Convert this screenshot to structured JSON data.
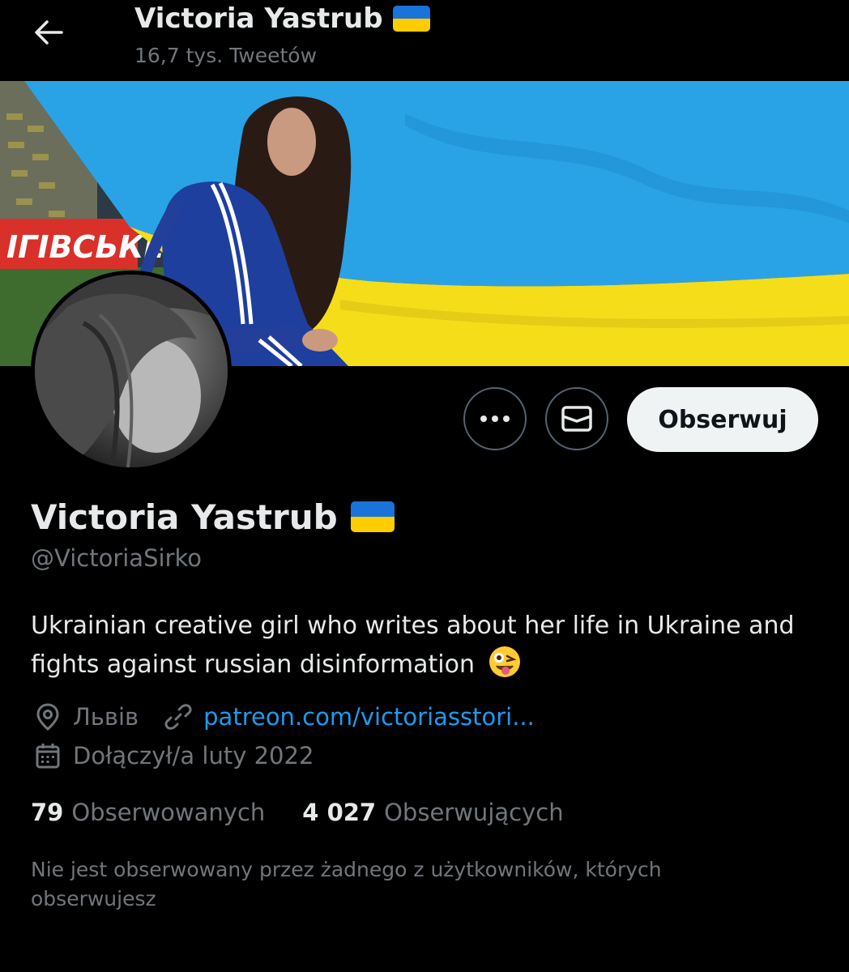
{
  "header": {
    "name": "Victoria Yastrub",
    "tweet_count": "16,7 tys. Tweetów",
    "back_icon": "arrow-left-icon"
  },
  "banner": {
    "sign_text": "ІГІВСЬКЕ",
    "flag_colors": {
      "blue": "#29a3e6",
      "yellow": "#f5dd1a"
    }
  },
  "actions": {
    "more_icon": "more-horizontal-icon",
    "message_icon": "envelope-icon",
    "follow_label": "Obserwuj"
  },
  "profile": {
    "display_name": "Victoria Yastrub",
    "handle": "@VictoriaSirko",
    "bio": "Ukrainian creative girl who writes about her life in Ukraine and fights against russian disinformation",
    "bio_emoji": "winking-face-with-tongue-emoji",
    "location": "Львів",
    "website": "patreon.com/victoriasstori...",
    "joined": "Dołączył/a luty 2022"
  },
  "stats": {
    "following_count": "79",
    "following_label": "Obserwowanych",
    "followers_count": "4 027",
    "followers_label": "Obserwujących"
  },
  "note": "Nie jest obserwowany przez żadnego z użytkowników, których obserwujesz",
  "colors": {
    "background": "#000000",
    "text": "#e7e9ea",
    "secondary": "#71767b",
    "link": "#1d9bf0",
    "flag_blue": "#1a73d9",
    "flag_yellow": "#ffcc00"
  }
}
